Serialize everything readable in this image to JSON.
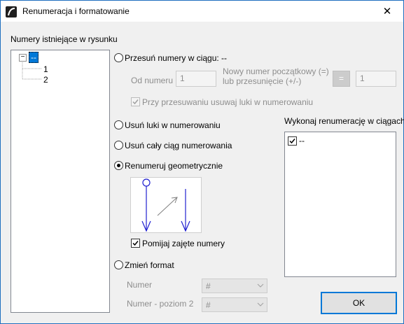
{
  "window": {
    "title": "Renumeracja i formatowanie",
    "close_glyph": "✕"
  },
  "left": {
    "label": "Numery istniejące w rysunku",
    "tree": {
      "root": "--",
      "expander": "−",
      "children": [
        "1",
        "2"
      ]
    }
  },
  "shift": {
    "label": "Przesuń numery w ciągu: --",
    "from_label": "Od numeru",
    "from_value": "1",
    "new_label_1": "Nowy numer początkowy (=)",
    "new_label_2": "lub przesunięcie (+/-)",
    "equals": "=",
    "new_value": "1",
    "remove_gaps_check": "Przy przesuwaniu usuwaj luki w numerowaniu"
  },
  "options": {
    "remove_gaps": "Usuń luki w numerowaniu",
    "remove_sequence": "Usuń cały ciąg numerowania",
    "geometric": "Renumeruj geometrycznie",
    "skip_taken": "Pomijaj zajęte numery",
    "change_format": "Zmień format"
  },
  "format": {
    "numer_label": "Numer",
    "numer_value": "#",
    "level2_label": "Numer - poziom 2",
    "level2_value": "#"
  },
  "sequences": {
    "label": "Wykonaj renumerację w ciągach",
    "items": [
      "--"
    ]
  },
  "ok_label": "OK",
  "colors": {
    "accent": "#0078d7",
    "preview_line": "#1f1fd0"
  }
}
